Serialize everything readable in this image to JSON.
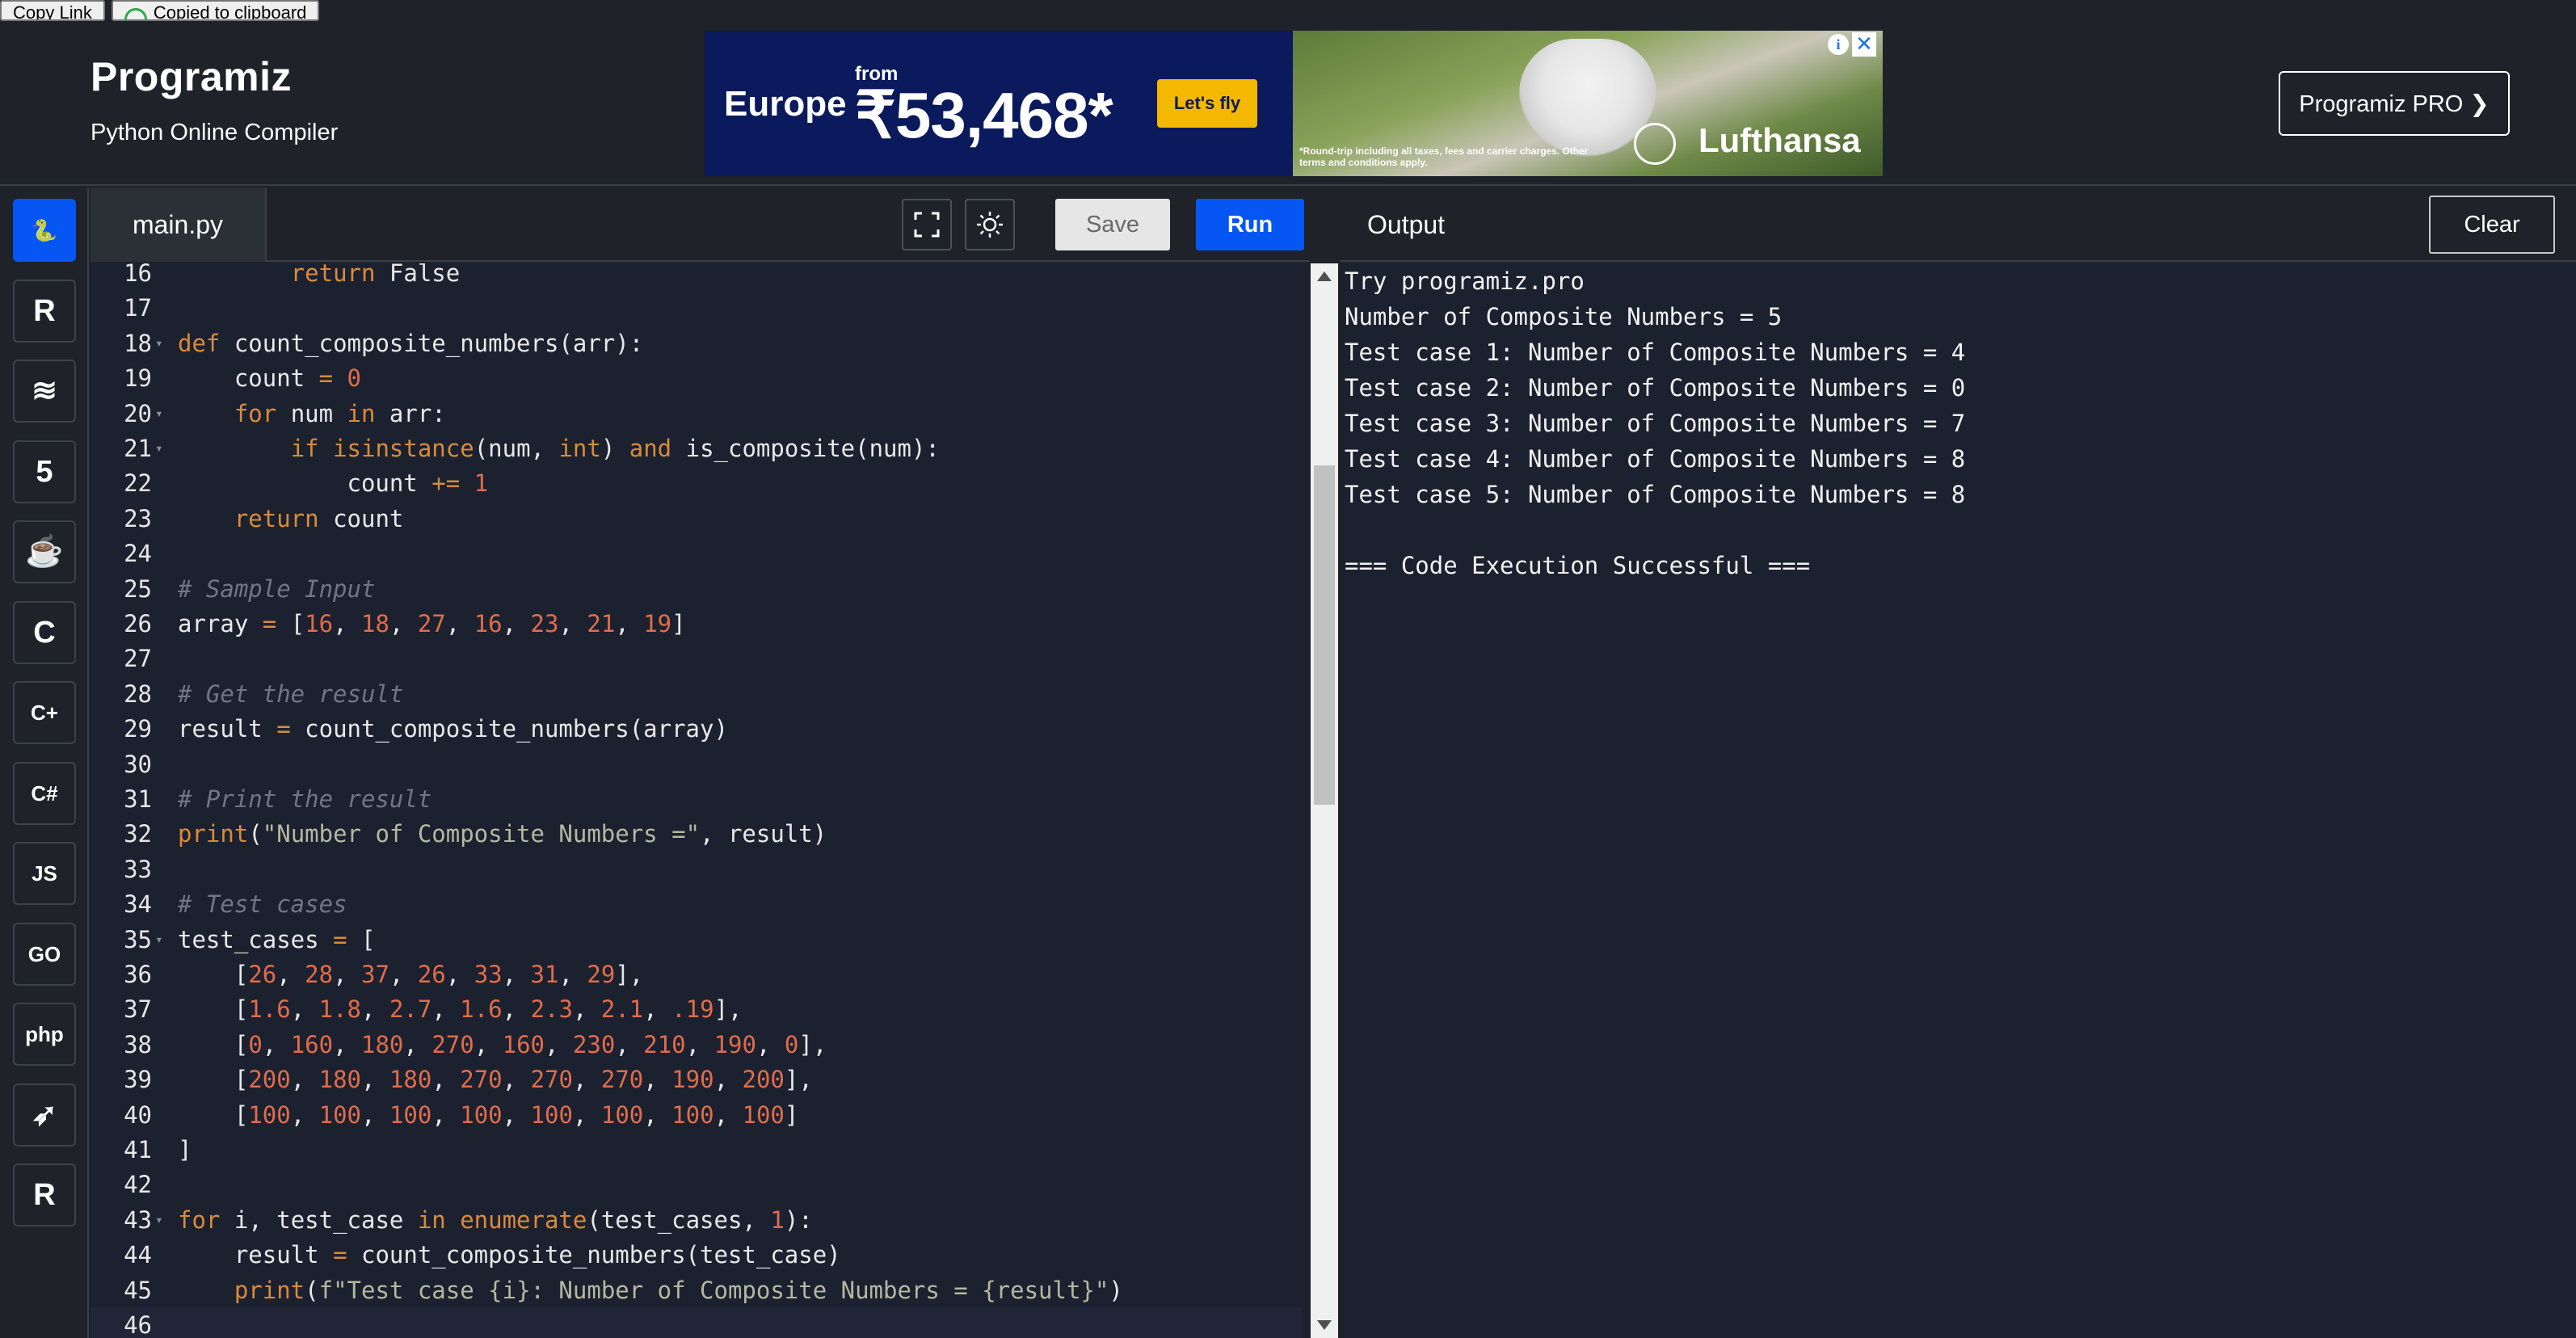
{
  "top_strip": {
    "copy_link": "Copy Link",
    "copied": "Copied to clipboard"
  },
  "header": {
    "logo": "Programiz",
    "subtitle": "Python Online Compiler",
    "pro_button": "Programiz PRO ❯"
  },
  "ad": {
    "destination": "Europe",
    "from": "from",
    "price": "₹53,468*",
    "cta": "Let's fly",
    "fine_print": "*Round-trip including all taxes, fees and carrier charges. Other terms and conditions apply.",
    "brand": "Lufthansa"
  },
  "languages": [
    {
      "name": "python-icon",
      "glyph": "🐍",
      "active": true
    },
    {
      "name": "r-icon",
      "glyph": "R"
    },
    {
      "name": "sql-icon",
      "glyph": "≋"
    },
    {
      "name": "html-icon",
      "glyph": "5"
    },
    {
      "name": "java-icon",
      "glyph": "☕"
    },
    {
      "name": "c-icon",
      "glyph": "C"
    },
    {
      "name": "cpp-icon",
      "glyph": "C+"
    },
    {
      "name": "csharp-icon",
      "glyph": "C#"
    },
    {
      "name": "js-icon",
      "glyph": "JS"
    },
    {
      "name": "go-icon",
      "glyph": "GO"
    },
    {
      "name": "php-icon",
      "glyph": "php"
    },
    {
      "name": "swift-icon",
      "glyph": "➶"
    },
    {
      "name": "rust-icon",
      "glyph": "R"
    }
  ],
  "editor": {
    "file_tab": "main.py",
    "save_label": "Save",
    "run_label": "Run",
    "lines": [
      {
        "n": "16",
        "code": "        return False"
      },
      {
        "n": "17",
        "code": ""
      },
      {
        "n": "18",
        "code": "def count_composite_numbers(arr):"
      },
      {
        "n": "19",
        "code": "    count = 0"
      },
      {
        "n": "20",
        "code": "    for num in arr:"
      },
      {
        "n": "21",
        "code": "        if isinstance(num, int) and is_composite(num):"
      },
      {
        "n": "22",
        "code": "            count += 1"
      },
      {
        "n": "23",
        "code": "    return count"
      },
      {
        "n": "24",
        "code": ""
      },
      {
        "n": "25",
        "code": "# Sample Input"
      },
      {
        "n": "26",
        "code": "array = [16, 18, 27, 16, 23, 21, 19]"
      },
      {
        "n": "27",
        "code": ""
      },
      {
        "n": "28",
        "code": "# Get the result"
      },
      {
        "n": "29",
        "code": "result = count_composite_numbers(array)"
      },
      {
        "n": "30",
        "code": ""
      },
      {
        "n": "31",
        "code": "# Print the result"
      },
      {
        "n": "32",
        "code": "print(\"Number of Composite Numbers =\", result)"
      },
      {
        "n": "33",
        "code": ""
      },
      {
        "n": "34",
        "code": "# Test cases"
      },
      {
        "n": "35",
        "code": "test_cases = ["
      },
      {
        "n": "36",
        "code": "    [26, 28, 37, 26, 33, 31, 29],"
      },
      {
        "n": "37",
        "code": "    [1.6, 1.8, 2.7, 1.6, 2.3, 2.1, .19],"
      },
      {
        "n": "38",
        "code": "    [0, 160, 180, 270, 160, 230, 210, 190, 0],"
      },
      {
        "n": "39",
        "code": "    [200, 180, 180, 270, 270, 270, 190, 200],"
      },
      {
        "n": "40",
        "code": "    [100, 100, 100, 100, 100, 100, 100, 100]"
      },
      {
        "n": "41",
        "code": "]"
      },
      {
        "n": "42",
        "code": ""
      },
      {
        "n": "43",
        "code": "for i, test_case in enumerate(test_cases, 1):"
      },
      {
        "n": "44",
        "code": "    result = count_composite_numbers(test_case)"
      },
      {
        "n": "45",
        "code": "    print(f\"Test case {i}: Number of Composite Numbers = {result}\")"
      },
      {
        "n": "46",
        "code": ""
      }
    ]
  },
  "output": {
    "title": "Output",
    "clear_label": "Clear",
    "lines": [
      "Try programiz.pro",
      "Number of Composite Numbers = 5",
      "Test case 1: Number of Composite Numbers = 4",
      "Test case 2: Number of Composite Numbers = 0",
      "Test case 3: Number of Composite Numbers = 7",
      "Test case 4: Number of Composite Numbers = 8",
      "Test case 5: Number of Composite Numbers = 8",
      "",
      "=== Code Execution Successful ==="
    ]
  },
  "colors": {
    "accent": "#0556f3",
    "background": "#1f2228",
    "editor_bg": "#1c2130"
  }
}
